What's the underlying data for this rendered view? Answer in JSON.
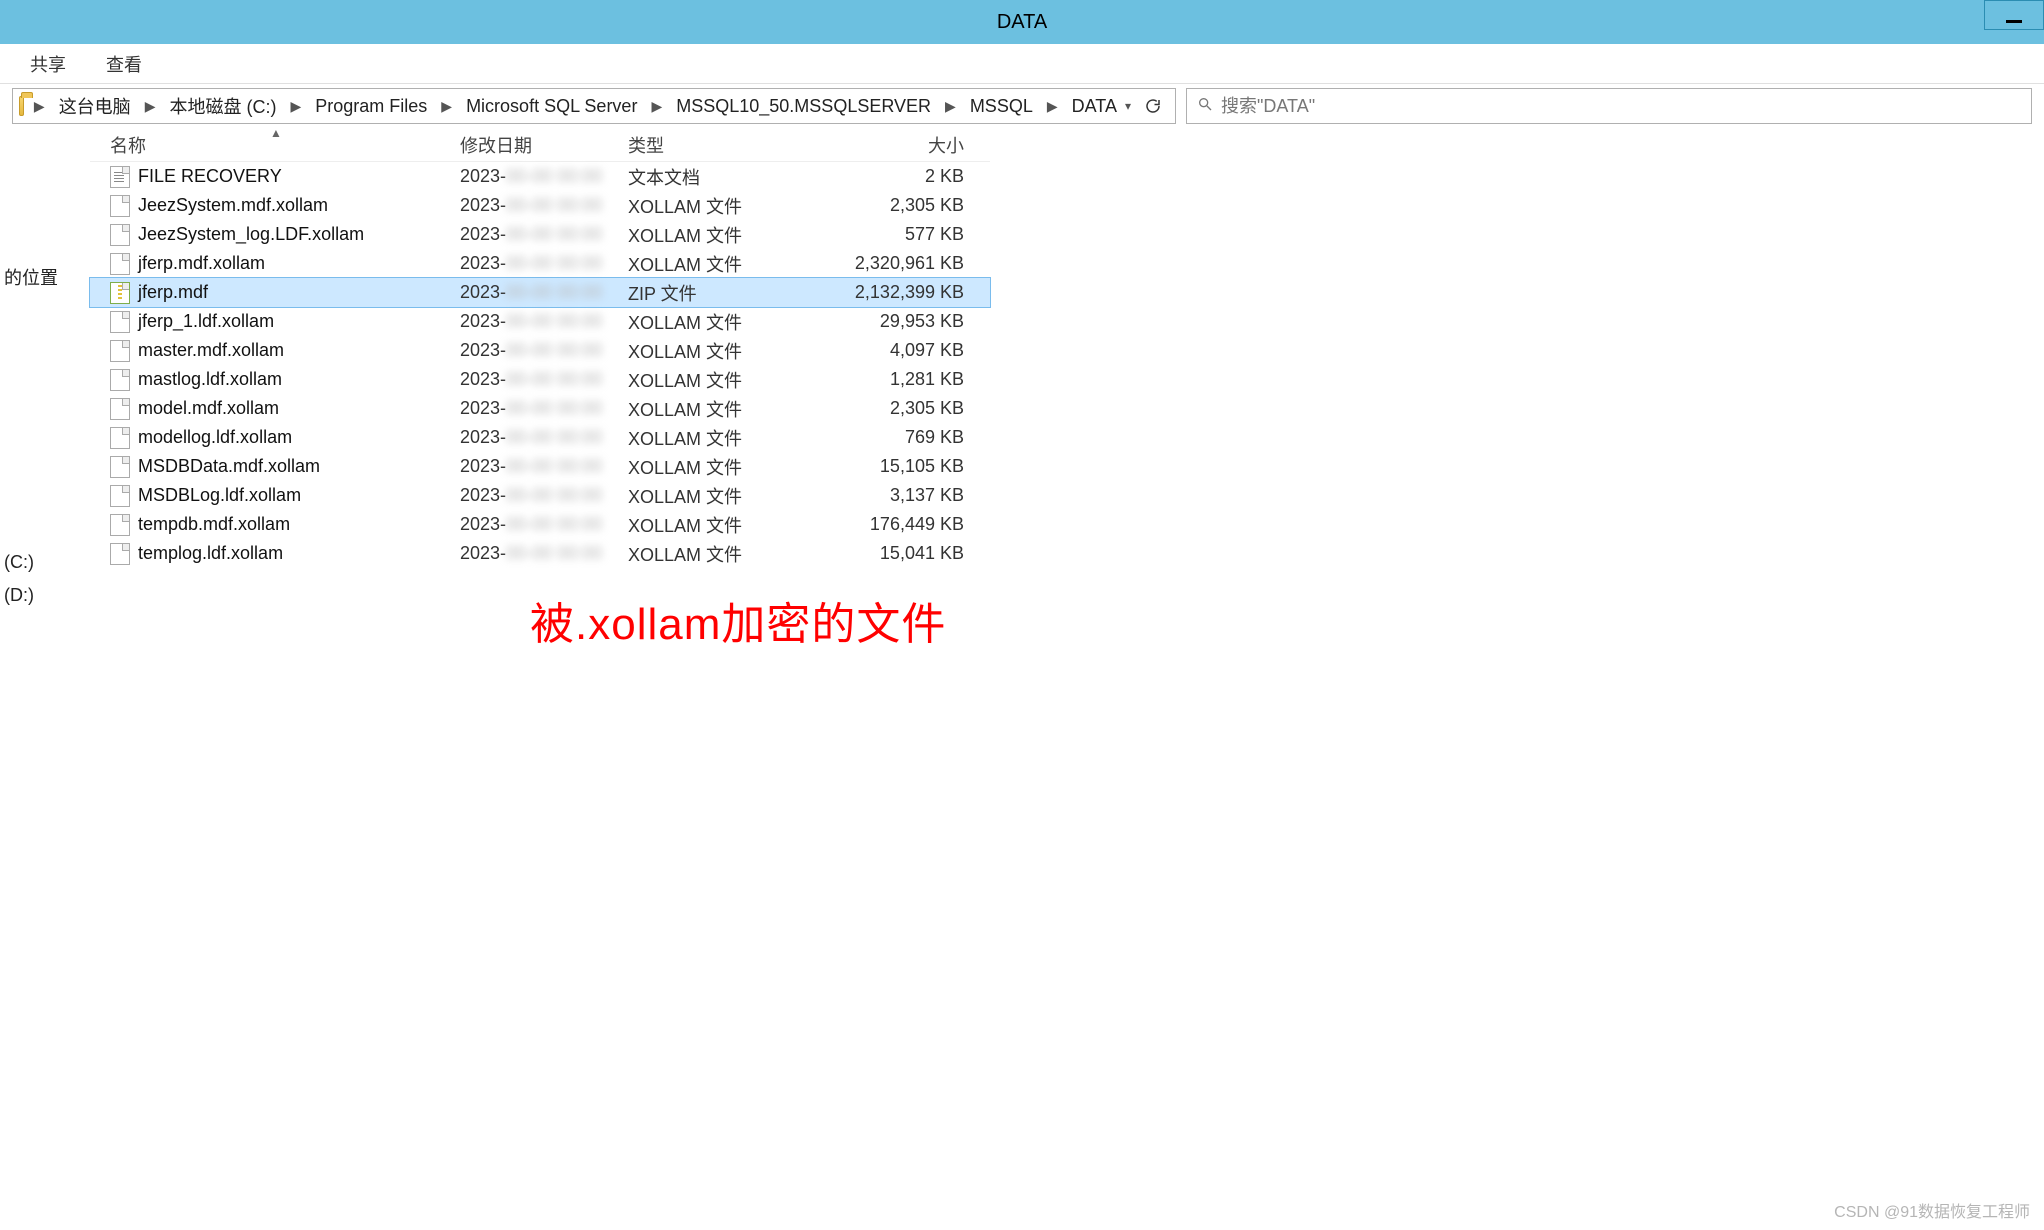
{
  "window": {
    "title": "DATA"
  },
  "menu": {
    "share": "共享",
    "view": "查看"
  },
  "breadcrumbs": [
    "这台电脑",
    "本地磁盘 (C:)",
    "Program Files",
    "Microsoft SQL Server",
    "MSSQL10_50.MSSQLSERVER",
    "MSSQL",
    "DATA"
  ],
  "search": {
    "placeholder": "搜索\"DATA\""
  },
  "sidebar": {
    "loc": "的位置",
    "c": "(C:)",
    "d": "(D:)"
  },
  "columns": {
    "name": "名称",
    "date": "修改日期",
    "type": "类型",
    "size": "大小"
  },
  "files": [
    {
      "name": "FILE RECOVERY",
      "date_vis": "2023-",
      "type": "文本文档",
      "size": "2 KB",
      "icon": "txt",
      "sel": false
    },
    {
      "name": "JeezSystem.mdf.xollam",
      "date_vis": "2023-",
      "type": "XOLLAM 文件",
      "size": "2,305 KB",
      "icon": "file",
      "sel": false
    },
    {
      "name": "JeezSystem_log.LDF.xollam",
      "date_vis": "2023-",
      "type": "XOLLAM 文件",
      "size": "577 KB",
      "icon": "file",
      "sel": false
    },
    {
      "name": "jferp.mdf.xollam",
      "date_vis": "2023-",
      "type": "XOLLAM 文件",
      "size": "2,320,961 KB",
      "icon": "file",
      "sel": false
    },
    {
      "name": "jferp.mdf",
      "date_vis": "2023-",
      "type": "ZIP 文件",
      "size": "2,132,399 KB",
      "icon": "zip",
      "sel": true
    },
    {
      "name": "jferp_1.ldf.xollam",
      "date_vis": "2023-",
      "type": "XOLLAM 文件",
      "size": "29,953 KB",
      "icon": "file",
      "sel": false
    },
    {
      "name": "master.mdf.xollam",
      "date_vis": "2023-",
      "type": "XOLLAM 文件",
      "size": "4,097 KB",
      "icon": "file",
      "sel": false
    },
    {
      "name": "mastlog.ldf.xollam",
      "date_vis": "2023-",
      "type": "XOLLAM 文件",
      "size": "1,281 KB",
      "icon": "file",
      "sel": false
    },
    {
      "name": "model.mdf.xollam",
      "date_vis": "2023-",
      "type": "XOLLAM 文件",
      "size": "2,305 KB",
      "icon": "file",
      "sel": false
    },
    {
      "name": "modellog.ldf.xollam",
      "date_vis": "2023-",
      "type": "XOLLAM 文件",
      "size": "769 KB",
      "icon": "file",
      "sel": false
    },
    {
      "name": "MSDBData.mdf.xollam",
      "date_vis": "2023-",
      "type": "XOLLAM 文件",
      "size": "15,105 KB",
      "icon": "file",
      "sel": false
    },
    {
      "name": "MSDBLog.ldf.xollam",
      "date_vis": "2023-",
      "type": "XOLLAM 文件",
      "size": "3,137 KB",
      "icon": "file",
      "sel": false
    },
    {
      "name": "tempdb.mdf.xollam",
      "date_vis": "2023-",
      "type": "XOLLAM 文件",
      "size": "176,449 KB",
      "icon": "file",
      "sel": false
    },
    {
      "name": "templog.ldf.xollam",
      "date_vis": "2023-",
      "type": "XOLLAM 文件",
      "size": "15,041 KB",
      "icon": "file",
      "sel": false
    }
  ],
  "annotation": "被.xollam加密的文件",
  "watermark": "CSDN @91数据恢复工程师"
}
